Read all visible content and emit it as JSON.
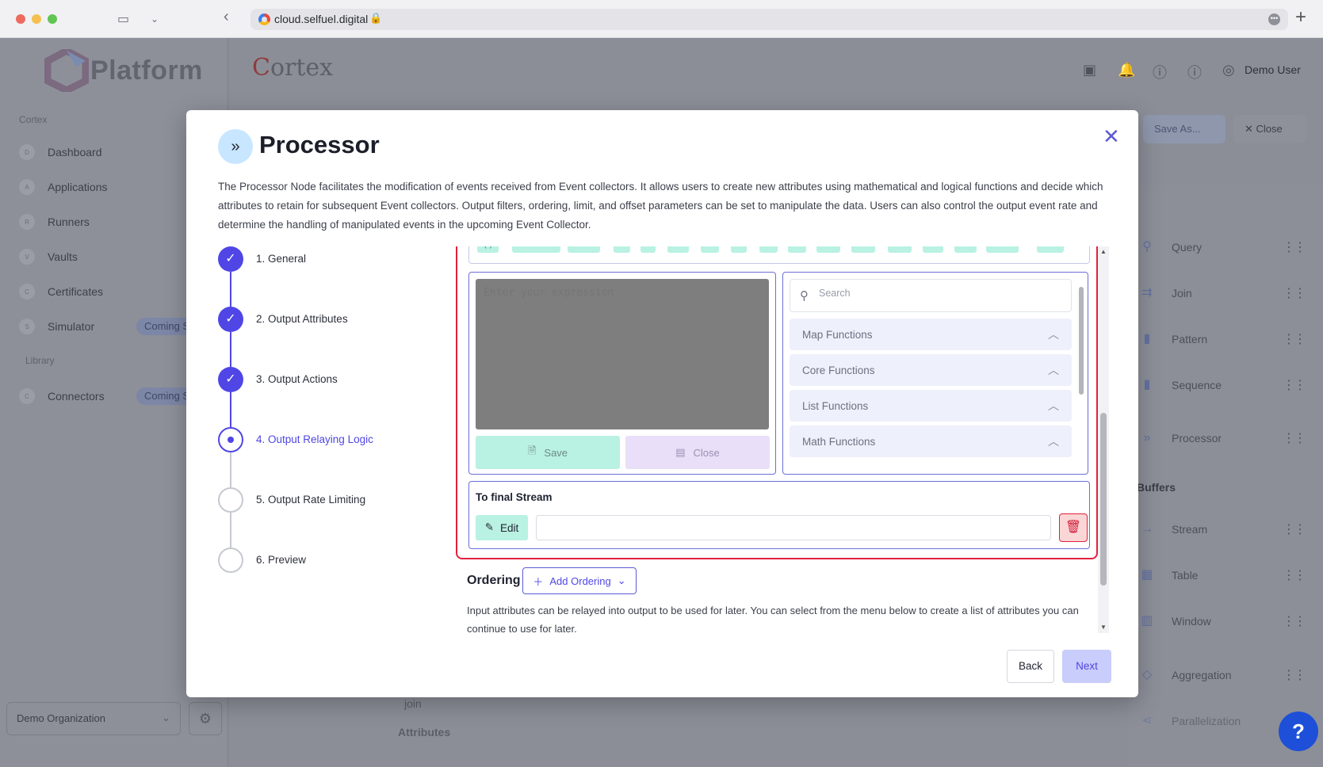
{
  "browser": {
    "url": "cloud.selfuel.digital"
  },
  "app": {
    "brand": "Platform",
    "product": "ortex",
    "product_initial": "C",
    "user": "Demo User",
    "sidebar": {
      "section_cortex": "Cortex",
      "items": [
        {
          "badge": "D",
          "label": "Dashboard"
        },
        {
          "badge": "A",
          "label": "Applications"
        },
        {
          "badge": "R",
          "label": "Runners"
        },
        {
          "badge": "V",
          "label": "Vaults"
        },
        {
          "badge": "C",
          "label": "Certificates"
        },
        {
          "badge": "S",
          "label": "Simulator",
          "tag": "Coming Soon"
        }
      ],
      "section_library": "Library",
      "library_items": [
        {
          "badge": "C",
          "label": "Connectors",
          "tag": "Coming Soon"
        }
      ],
      "organization": "Demo Organization"
    },
    "toolbar": {
      "save_as": "Save As...",
      "close": "Close"
    },
    "palette": {
      "items": [
        "Query",
        "Join",
        "Pattern",
        "Sequence",
        "Processor"
      ],
      "buffers_title": "Buffers",
      "buffers": [
        "Stream",
        "Table",
        "Window"
      ],
      "more": [
        "Aggregation",
        "Parallelization"
      ]
    },
    "canvas": {
      "node_text": "join",
      "attributes_label": "Attributes"
    },
    "help": "?"
  },
  "modal": {
    "title": "Processor",
    "description": "The Processor Node facilitates the modification of events received from Event collectors. It allows users to create new attributes using mathematical and logical functions and decide which attributes to retain for subsequent Event collectors. Output filters, ordering, limit, and offset parameters can be set to manipulate the data. Users can also control the output event rate and determine the handling of manipulated events in the upcoming Event Collector.",
    "steps": [
      {
        "label": "1. General",
        "state": "done"
      },
      {
        "label": "2. Output Attributes",
        "state": "done"
      },
      {
        "label": "3. Output Actions",
        "state": "done"
      },
      {
        "label": "4. Output Relaying Logic",
        "state": "active"
      },
      {
        "label": "5. Output Rate Limiting",
        "state": "todo"
      },
      {
        "label": "6. Preview",
        "state": "todo"
      }
    ],
    "operators": [
      "( )",
      "IS NULL",
      "NOT",
      "*",
      "/",
      "%",
      "+",
      "-",
      "<",
      ">",
      "<=",
      ">=",
      "==",
      "!=",
      "IN",
      "AND",
      "OR"
    ],
    "expression": {
      "placeholder": "Enter your expression",
      "save_label": "Save",
      "close_label": "Close"
    },
    "functions": {
      "search_placeholder": "Search",
      "groups": [
        "Map Functions",
        "Core Functions",
        "List Functions",
        "Math Functions"
      ]
    },
    "final_stream": {
      "title": "To final Stream",
      "edit_label": "Edit",
      "value": ""
    },
    "ordering": {
      "label": "Ordering",
      "add_label": "Add Ordering",
      "description": "Input attributes can be relayed into output to be used for later. You can select from the menu below to create a list of attributes you can continue to use for later."
    },
    "back_label": "Back",
    "next_label": "Next"
  }
}
